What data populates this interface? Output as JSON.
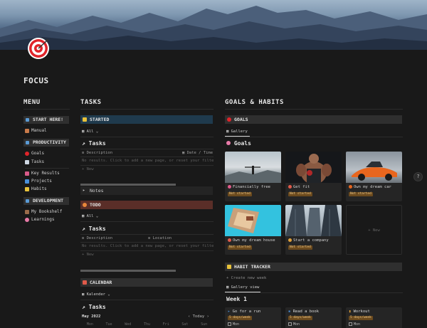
{
  "page": {
    "title": "FOCUS"
  },
  "icons": {
    "page_icon": "target-icon"
  },
  "colors": {
    "background": "#191919",
    "tasks_started": "#1f3a4d",
    "tasks_todo": "#5a2e28",
    "badge": "#6b4a1e",
    "badge_text": "#f0c987"
  },
  "menu": {
    "heading": "MENU",
    "start_label": "START HERE!",
    "manual": "Manual",
    "productivity_label": "PRODUCTIVITY",
    "goals": "Goals",
    "tasks": "Tasks",
    "key_results": "Key Results",
    "projects": "Projects",
    "habits": "Habits",
    "development_label": "DEVELOPMENT",
    "bookshelf": "My Bookshelf",
    "learnings": "Learnings"
  },
  "tasks": {
    "heading": "TASKS",
    "started": {
      "label": "STARTED",
      "view": "All",
      "title": "Tasks",
      "col1": "Description",
      "col2": "Date / Time",
      "empty": "No results. Click to add a new page, or reset your filters",
      "new": "+ New"
    },
    "notes": "Notes",
    "todo": {
      "label": "TODO",
      "view": "All",
      "title": "Tasks",
      "col1": "Description",
      "col2": "Location",
      "empty": "No results. Click to add a new page, or reset your filters",
      "new": "+ New"
    },
    "calendar": {
      "label": "CALENDAR",
      "view": "Kalender",
      "title": "Tasks",
      "month": "May 2022",
      "today": "Today",
      "weekdays": [
        "Mon",
        "Tue",
        "Wed",
        "Thu",
        "Fri",
        "Sat",
        "Sun"
      ]
    }
  },
  "goals_habits": {
    "heading": "GOALS & HABITS",
    "goals_label": "GOALS",
    "gallery_tab": "Gallery",
    "goals_title": "Goals",
    "cards": [
      {
        "title": "Financially free",
        "status": "Not started"
      },
      {
        "title": "Get fit",
        "status": "Not started"
      },
      {
        "title": "Own my dream car",
        "status": "Not started"
      },
      {
        "title": "Own my dream house",
        "status": "Not started"
      },
      {
        "title": "Start a company",
        "status": "Not started"
      }
    ],
    "new_card": "+ New",
    "habit_label": "HABIT TRACKER",
    "create_week": "+ Create new week",
    "gallery_view": "Gallery view",
    "week_title": "Week 1",
    "habits": [
      {
        "title": "Go for a run",
        "badge": "5 days/week",
        "day": "Mon"
      },
      {
        "title": "Read a book",
        "badge": "5 days/week",
        "day": "Mon"
      },
      {
        "title": "Workout",
        "badge": "5 days/week",
        "day": "Mon"
      }
    ]
  },
  "help": "?"
}
